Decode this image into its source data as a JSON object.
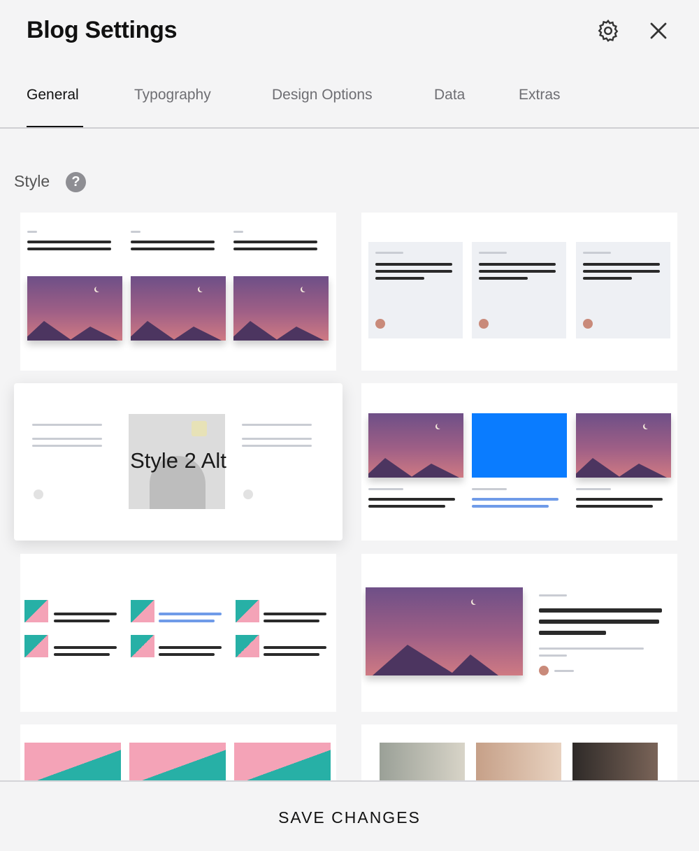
{
  "header": {
    "title": "Blog Settings"
  },
  "tabs": [
    {
      "label": "General",
      "active": true
    },
    {
      "label": "Typography",
      "active": false
    },
    {
      "label": "Design Options",
      "active": false
    },
    {
      "label": "Data",
      "active": false
    },
    {
      "label": "Extras",
      "active": false
    }
  ],
  "style_section": {
    "label": "Style",
    "help_icon": "?"
  },
  "style_options": [
    {
      "id": "style-1"
    },
    {
      "id": "style-2"
    },
    {
      "id": "style-2-alt",
      "hover_label": "Style 2 Alt"
    },
    {
      "id": "style-3"
    },
    {
      "id": "style-4"
    },
    {
      "id": "style-5"
    },
    {
      "id": "style-6"
    },
    {
      "id": "style-7"
    }
  ],
  "footer": {
    "save_label": "SAVE CHANGES"
  },
  "colors": {
    "accent_blue": "#0a7cff",
    "text": "#111111",
    "muted": "#6e6e73"
  }
}
